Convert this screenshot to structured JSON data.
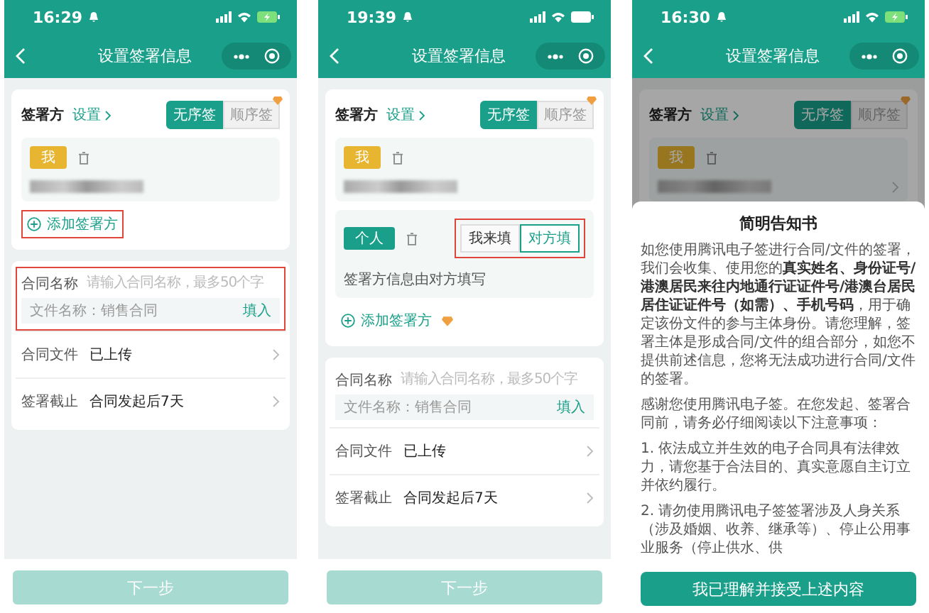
{
  "screens": [
    {
      "kind": "form",
      "status_bar": {
        "time": "16:29",
        "battery_charging": true
      },
      "title": "设置签署信息",
      "signers": {
        "label": "签署方",
        "link": "设置",
        "order_options": [
          {
            "label": "无序签",
            "selected": true
          },
          {
            "label": "顺序签",
            "selected": false
          }
        ],
        "parties": [
          {
            "kind": "self",
            "tag": "我"
          }
        ],
        "add": {
          "label": "添加签署方",
          "highlighted": true,
          "premium": false
        }
      },
      "contract": {
        "highlighted": true,
        "name_label": "合同名称",
        "name_placeholder": "请输入合同名称，最多50个字",
        "suggestion": "文件名称：销售合同",
        "fill": "填入",
        "rows": [
          {
            "label": "合同文件",
            "value": "已上传"
          },
          {
            "label": "签署截止",
            "value": "合同发起后7天"
          }
        ]
      },
      "next": "下一步"
    },
    {
      "kind": "form",
      "status_bar": {
        "time": "19:39",
        "battery_charging": false
      },
      "title": "设置签署信息",
      "signers": {
        "label": "签署方",
        "link": "设置",
        "order_options": [
          {
            "label": "无序签",
            "selected": true
          },
          {
            "label": "顺序签",
            "selected": false
          }
        ],
        "parties": [
          {
            "kind": "self",
            "tag": "我"
          },
          {
            "kind": "other",
            "tag": "个人",
            "note": "签署方信息由对方填写",
            "highlighted": true,
            "fill_modes": [
              {
                "label": "我来填",
                "selected": false
              },
              {
                "label": "对方填",
                "selected": true
              }
            ]
          }
        ],
        "add": {
          "label": "添加签署方",
          "highlighted": false,
          "premium": true
        }
      },
      "contract": {
        "highlighted": false,
        "name_label": "合同名称",
        "name_placeholder": "请输入合同名称，最多50个字",
        "suggestion": "文件名称：销售合同",
        "fill": "填入",
        "rows": [
          {
            "label": "合同文件",
            "value": "已上传"
          },
          {
            "label": "签署截止",
            "value": "合同发起后7天"
          }
        ]
      },
      "next": "下一步"
    },
    {
      "kind": "modal",
      "status_bar": {
        "time": "16:30",
        "battery_charging": true
      },
      "title": "设置签署信息",
      "signers": {
        "label": "签署方",
        "link": "设置",
        "order_options": [
          {
            "label": "无序签",
            "selected": true
          },
          {
            "label": "顺序签",
            "selected": false
          }
        ],
        "parties": [
          {
            "kind": "self",
            "tag": "我"
          }
        ]
      },
      "modal": {
        "title": "简明告知书",
        "paragraphs": [
          "如您使用腾讯电子签进行合同/文件的签署，我们会收集、使用您的**真实姓名、身份证号/港澳居民来往内地通行证证件号/港澳台居民居住证证件号（如需）、手机号码**，用于确定该份文件的参与主体身份。请您理解，签署主体是形成合同/文件的组合部分，如您不提供前述信息，您将无法成功进行合同/文件的签署。",
          "感谢您使用腾讯电子签。在您发起、签署合同前，请务必仔细阅读以下注意事项：",
          "1. 依法成立并生效的电子合同具有法律效力，请您基于合法目的、真实意愿自主订立并依约履行。",
          "2. 请勿使用腾讯电子签签署涉及人身关系（涉及婚姻、收养、继承等）、停止公用事业服务（停止供水、供"
        ],
        "button": "我已理解并接受上述内容"
      }
    }
  ]
}
